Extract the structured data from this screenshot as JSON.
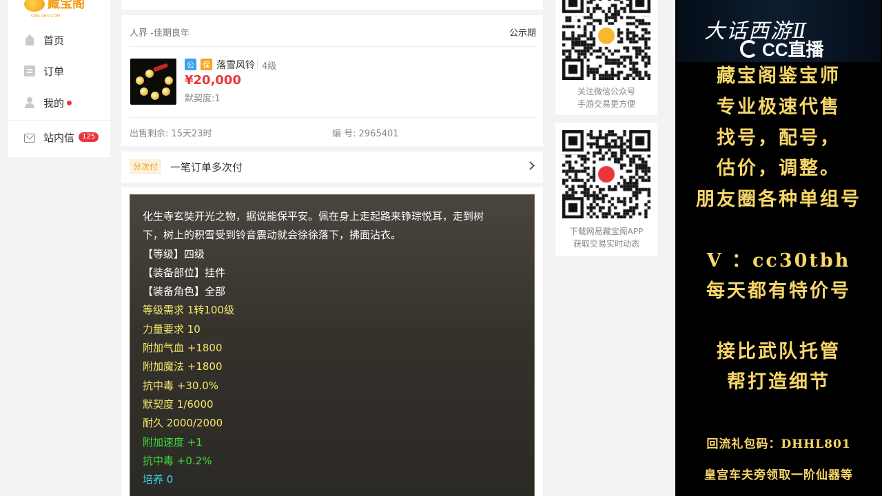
{
  "sidebar": {
    "logo": {
      "text": "藏宝阁",
      "sub": "CBG.163.COM"
    },
    "items": [
      {
        "label": "首页"
      },
      {
        "label": "订单"
      },
      {
        "label": "我的"
      },
      {
        "label": "站内信",
        "badge": "125"
      }
    ]
  },
  "item": {
    "breadcrumb": "人界 -佳期良年",
    "period": "公示期",
    "tags": [
      "公",
      "保"
    ],
    "name": "落雪风铃",
    "level": "4级",
    "price": "¥20,000",
    "affinity": "默契度:1",
    "remaining": "出售剩余:  15天23时",
    "serial": "编 号:  2965401"
  },
  "payment": {
    "tag": "分次付",
    "text": "一笔订单多次付"
  },
  "description": {
    "lines": [
      {
        "text": "化生寺玄奘开光之物，据说能保平安。佩在身上走起路来铮琮悦耳，走到树",
        "color": "white"
      },
      {
        "text": "下，树上的积雪受到铃音震动就会徐徐落下，拂面沾衣。",
        "color": "white"
      },
      {
        "text": "【等级】四级",
        "color": "white"
      },
      {
        "text": "【装备部位】挂件",
        "color": "white"
      },
      {
        "text": "【装备角色】全部",
        "color": "white"
      },
      {
        "text": "等级需求 1转100级",
        "color": "yellow"
      },
      {
        "text": "力量要求 10",
        "color": "yellow"
      },
      {
        "text": "附加气血 +1800",
        "color": "yellow"
      },
      {
        "text": "附加魔法 +1800",
        "color": "yellow"
      },
      {
        "text": "抗中毒 +30.0%",
        "color": "yellow"
      },
      {
        "text": "默契度 1/6000",
        "color": "yellow"
      },
      {
        "text": "耐久 2000/2000",
        "color": "yellow"
      },
      {
        "text": "附加速度 +1",
        "color": "green"
      },
      {
        "text": "抗中毒 +0.2%",
        "color": "green"
      },
      {
        "text": "培养 0",
        "color": "cyan"
      }
    ]
  },
  "qr_codes": [
    {
      "caption1": "关注微信公众号",
      "caption2": "手游交易更方便"
    },
    {
      "caption1": "下载网易藏宝阁APP",
      "caption2": "获取交易实时动态"
    }
  ],
  "overlay": {
    "game_title": "大话西游Ⅱ",
    "cc_text": "CC直播",
    "lines": [
      "藏宝阁鉴宝师",
      "专业极速代售",
      "找号，配号，",
      "估价，调整。",
      "朋友圈各种单组号",
      "V ：cc30tbh",
      "每天都有特价号",
      "接比武队托管",
      "帮打造细节",
      "回流礼包码：DHHL801",
      "皇宫车夫旁领取一阶仙器等"
    ]
  }
}
